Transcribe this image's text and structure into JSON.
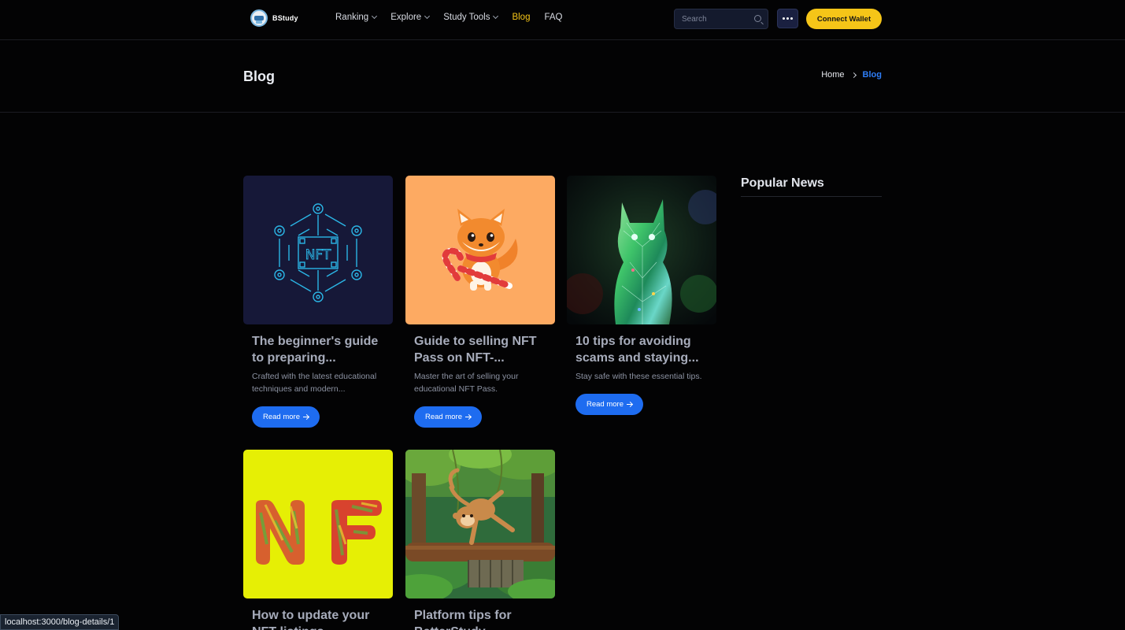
{
  "header": {
    "logo_text": "BStudy",
    "nav": [
      {
        "label": "Ranking",
        "dropdown": true,
        "active": false
      },
      {
        "label": "Explore",
        "dropdown": true,
        "active": false
      },
      {
        "label": "Study Tools",
        "dropdown": true,
        "active": false
      },
      {
        "label": "Blog",
        "dropdown": false,
        "active": true
      },
      {
        "label": "FAQ",
        "dropdown": false,
        "active": false
      }
    ],
    "search_placeholder": "Search",
    "more_icon": "ellipsis-icon",
    "connect_label": "Connect Wallet"
  },
  "page": {
    "title": "Blog",
    "breadcrumb": {
      "home": "Home",
      "current": "Blog"
    }
  },
  "posts": [
    {
      "title": "The beginner's guide to preparing...",
      "excerpt": "Crafted with the latest educational techniques and modern...",
      "read_more": "Read more",
      "image": "nft-network-illustration"
    },
    {
      "title": "Guide to selling NFT Pass on NFT-...",
      "excerpt": "Master the art of selling your educational NFT Pass.",
      "read_more": "Read more",
      "image": "fox-with-candy-cane"
    },
    {
      "title": "10 tips for avoiding scams and staying...",
      "excerpt": "Stay safe with these essential tips.",
      "read_more": "Read more",
      "image": "crystal-cat"
    },
    {
      "title": "How to update your NFT listings...",
      "excerpt": "",
      "read_more": "",
      "image": "nf-letters-on-yellow"
    },
    {
      "title": "Platform tips for BetterStudy...",
      "excerpt": "",
      "read_more": "",
      "image": "monkey-in-jungle"
    }
  ],
  "sidebar": {
    "title": "Popular News"
  },
  "status_bar": {
    "url": "localhost:3000/blog-details/1"
  },
  "colors": {
    "accent": "#f5c518",
    "link_blue": "#1e6cf0",
    "background": "#030304"
  }
}
